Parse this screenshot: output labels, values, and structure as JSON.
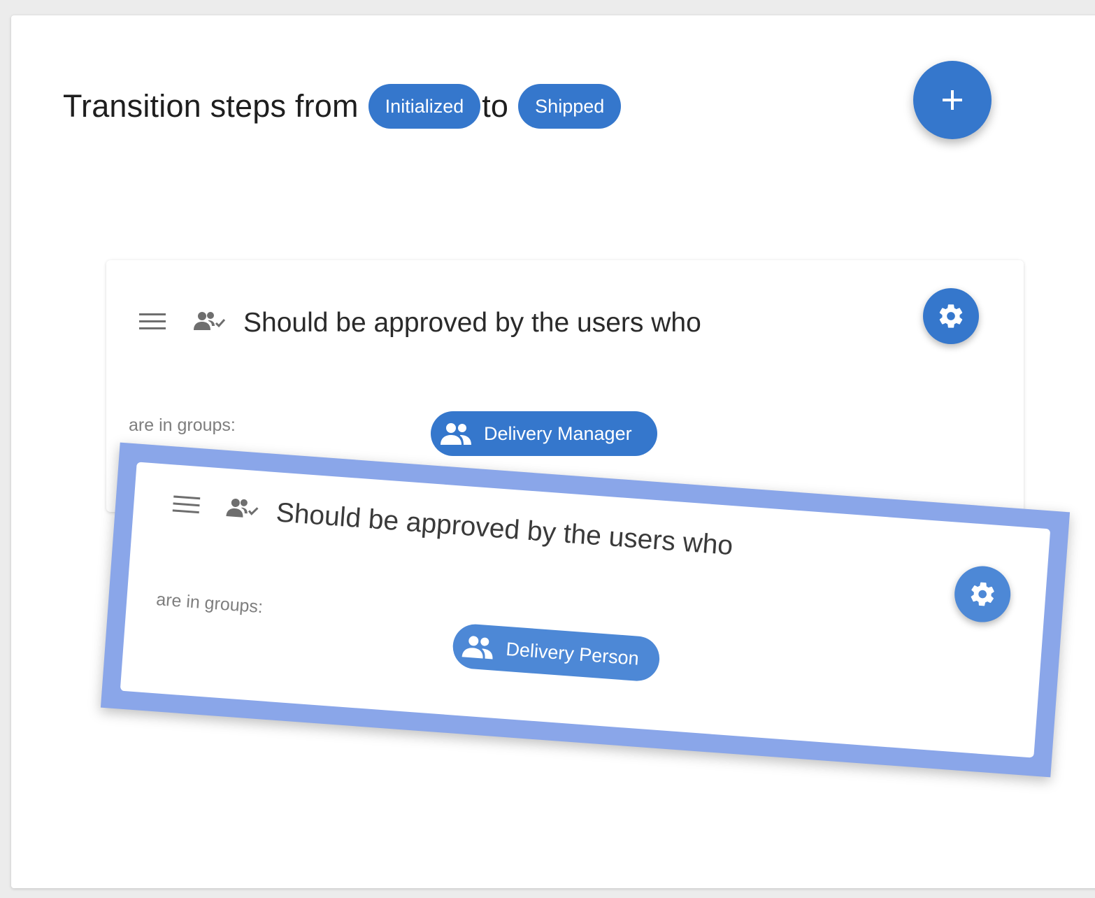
{
  "header": {
    "title_prefix": "Transition steps from",
    "from_state": "Initialized",
    "connector": "to",
    "to_state": "Shipped",
    "add_button_icon": "plus-icon"
  },
  "colors": {
    "accent": "#3577cc",
    "drag_outline": "#8aa6e9"
  },
  "steps": [
    {
      "handle_icon": "drag-handle-icon",
      "type_icon": "users-check-icon",
      "text": "Should be approved by the users who",
      "groups_label": "are in groups:",
      "group": "Delivery Manager",
      "group_icon": "group-icon",
      "settings_icon": "gear-icon"
    },
    {
      "handle_icon": "drag-handle-icon",
      "type_icon": "users-check-icon",
      "text": "Should be approved by the users who",
      "groups_label": "are in groups:",
      "group": "Delivery Person",
      "group_icon": "group-icon",
      "settings_icon": "gear-icon",
      "state": "dragging"
    }
  ]
}
